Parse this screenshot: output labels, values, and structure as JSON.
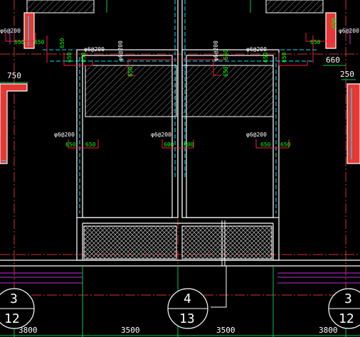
{
  "colors": {
    "background": "#000000",
    "wall": "#ffffff",
    "wall_fill": "#e53935",
    "axis": "#d32f2f",
    "rebar": "#00e5ff",
    "dimension": "#00ff00",
    "annotation": "#ff1744",
    "label": "#ffffff",
    "purple": "#9c27b0",
    "hatch": "#bdbdbd",
    "green": "#00c853"
  },
  "rebar_labels": {
    "top_left_a": "φ6@200",
    "top_left_b": "φ6@200",
    "top_center_left": "φ6@200",
    "top_center_right": "φ6@200",
    "top_right": "φ6@200",
    "top_right_a": "φ6@200",
    "mid_left": "φ6@200",
    "mid_center": "φ6@200",
    "mid_right": "φ6@200"
  },
  "lengths": {
    "l_650": "650",
    "l_600": "600"
  },
  "dimensions": {
    "d750": "750",
    "d660": "660",
    "d250": "250",
    "d3800_left": "3800",
    "d3500_left": "3500",
    "d3500_right": "3500",
    "d3800_right": "3800"
  },
  "axis_bubbles": [
    {
      "top": "3",
      "bottom": "12"
    },
    {
      "top": "4",
      "bottom": "13"
    },
    {
      "top": "3",
      "bottom": "12"
    }
  ]
}
